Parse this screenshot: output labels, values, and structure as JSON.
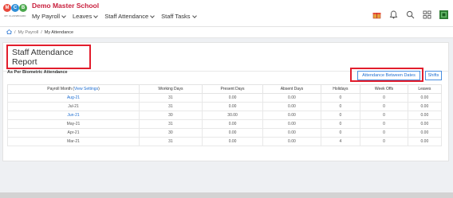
{
  "header": {
    "school_name": "Demo Master School",
    "logo_letters": [
      "M",
      "C",
      "B"
    ],
    "logo_tagline": "MY CLASSBOARD",
    "nav": [
      {
        "label": "My Payroll",
        "has_dropdown": true
      },
      {
        "label": "Leaves",
        "has_dropdown": true
      },
      {
        "label": "Staff Attendance",
        "has_dropdown": true
      },
      {
        "label": "Staff Tasks",
        "has_dropdown": true
      }
    ],
    "tool_icons": [
      "gift-icon",
      "bell-icon",
      "search-icon",
      "grid-icon",
      "profile-icon"
    ]
  },
  "breadcrumb": {
    "home_icon": "home-icon",
    "items": [
      "My Payroll",
      "My Attendance"
    ],
    "separator": "/"
  },
  "page": {
    "title": "Staff Attendance Report",
    "subtitle": "As Per Biometric Attendance",
    "buttons": {
      "between_dates": "Attendance Between Dates",
      "shifts": "Shifts"
    }
  },
  "table": {
    "header_month_prefix": "Payroll Month",
    "header_month_link": "View Settings",
    "columns": [
      "Working Days",
      "Present Days",
      "Absent Days",
      "Holidays",
      "Week Offs",
      "Leaves"
    ],
    "rows": [
      {
        "month": "Aug-21",
        "cells": [
          "31",
          "0.00",
          "0.00",
          "0",
          "0",
          "0.00"
        ],
        "link": true
      },
      {
        "month": "Jul-21",
        "cells": [
          "31",
          "0.00",
          "0.00",
          "0",
          "0",
          "0.00"
        ],
        "link": false
      },
      {
        "month": "Jun-21",
        "cells": [
          "30",
          "30.00",
          "0.00",
          "0",
          "0",
          "0.00"
        ],
        "link": true
      },
      {
        "month": "May-21",
        "cells": [
          "31",
          "0.00",
          "0.00",
          "0",
          "0",
          "0.00"
        ],
        "link": false
      },
      {
        "month": "Apr-21",
        "cells": [
          "30",
          "0.00",
          "0.00",
          "0",
          "0",
          "0.00"
        ],
        "link": false
      },
      {
        "month": "Mar-21",
        "cells": [
          "31",
          "0.00",
          "0.00",
          "4",
          "0",
          "0.00"
        ],
        "link": false
      }
    ]
  },
  "colors": {
    "brand_red": "#c81e3c",
    "highlight_red": "#e21d2c",
    "link_blue": "#1f6fd1"
  }
}
